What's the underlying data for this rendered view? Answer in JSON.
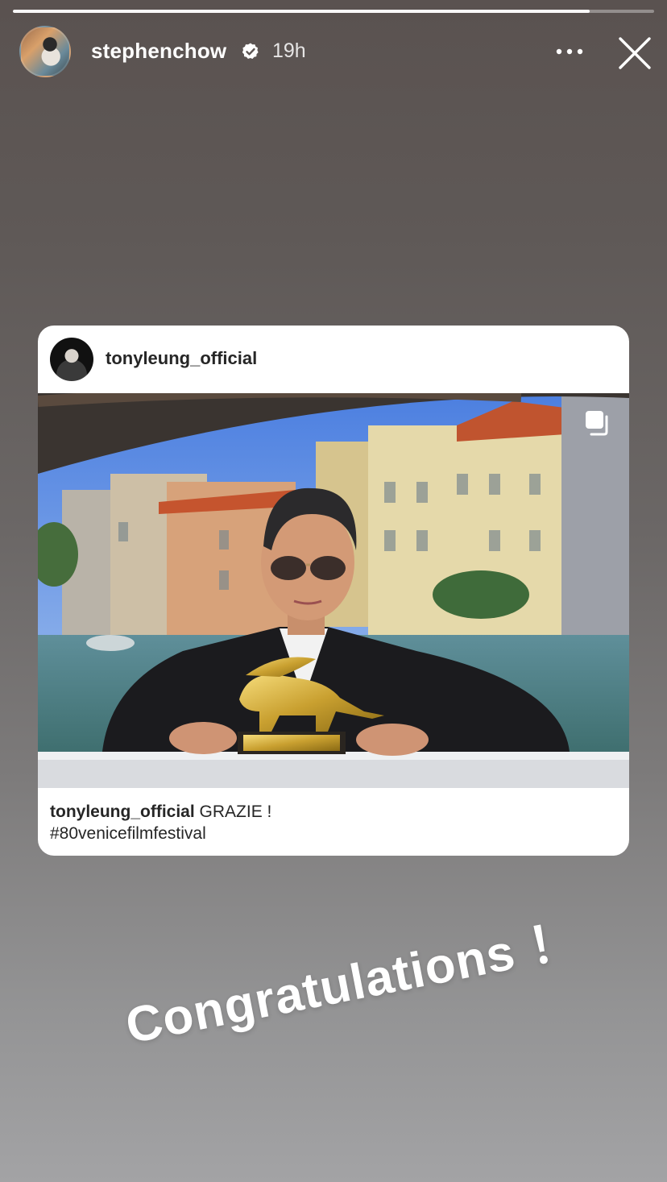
{
  "story": {
    "progress": 0.9,
    "username": "stephenchow",
    "verified": true,
    "timestamp": "19h",
    "more_icon": "more-horizontal-icon",
    "close_icon": "close-icon"
  },
  "shared_post": {
    "username": "tonyleung_official",
    "multi_image_icon": "carousel-icon",
    "caption_username": "tonyleung_official",
    "caption_text": "GRAZIE !",
    "hashtag": "#80venicefilmfestival"
  },
  "sticker": {
    "text": "Congratulations ！"
  },
  "colors": {
    "verified_badge": "#ffffff",
    "card_background": "#ffffff",
    "card_text": "#262626"
  }
}
